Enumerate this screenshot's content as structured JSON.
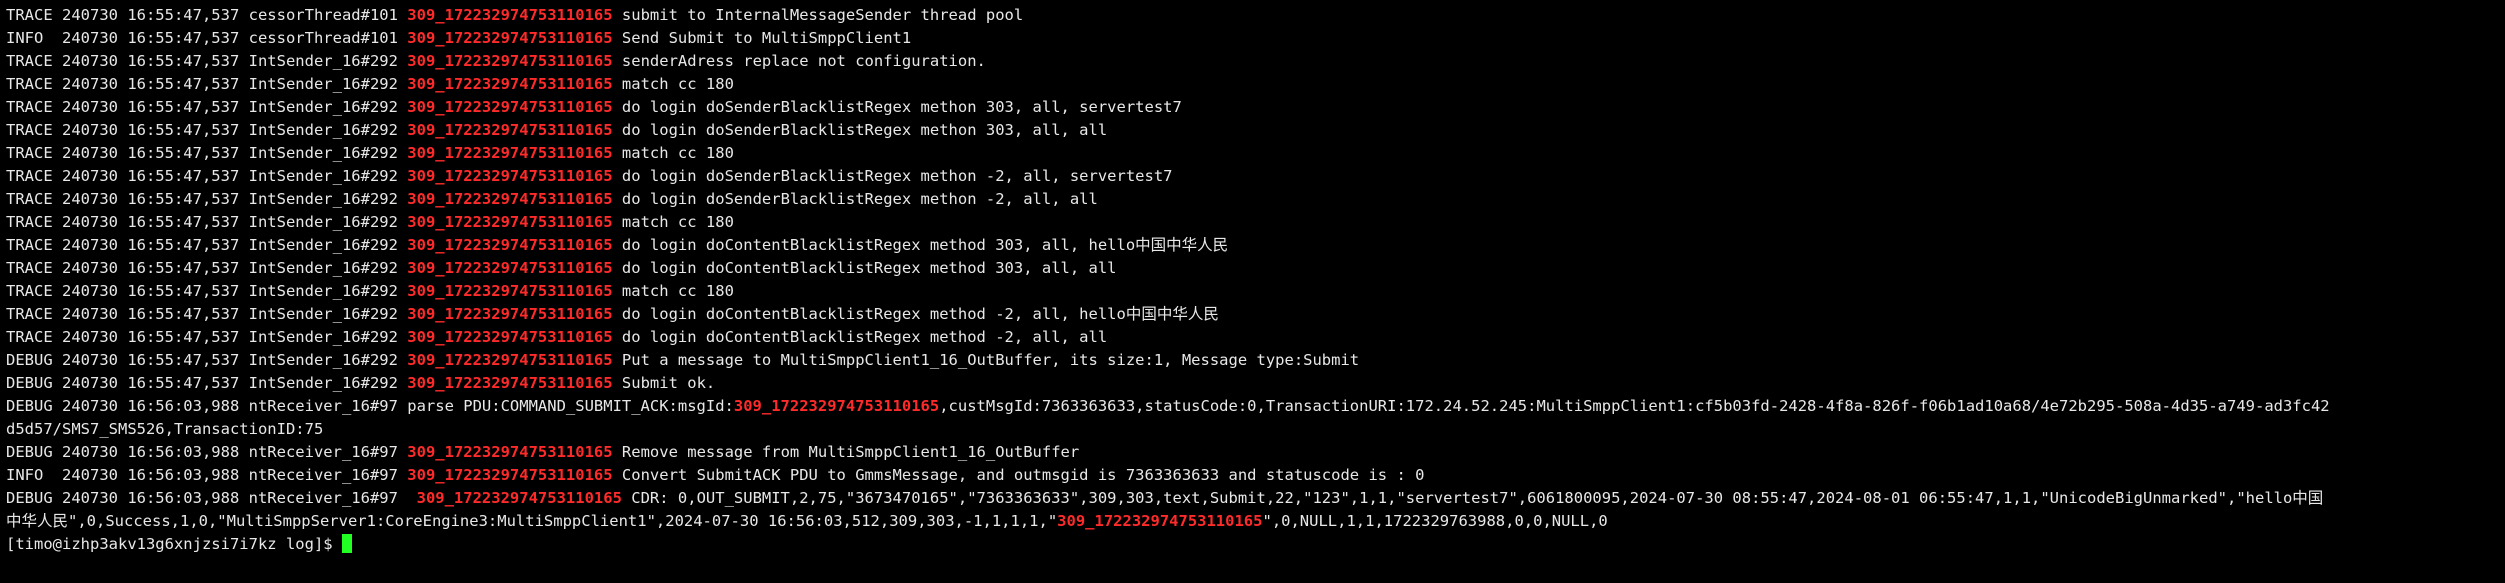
{
  "terminal": {
    "colors": {
      "background": "#000000",
      "foreground": "#e8e8e8",
      "highlight": "#ff2a2a",
      "cursor": "#22ff22"
    },
    "lines": [
      [
        {
          "t": "TRACE 240730 16:55:47,537 cessorThread#101 "
        },
        {
          "t": "309_172232974753110165",
          "red": true
        },
        {
          "t": " submit to InternalMessageSender thread pool"
        }
      ],
      [
        {
          "t": "INFO  240730 16:55:47,537 cessorThread#101 "
        },
        {
          "t": "309_172232974753110165",
          "red": true
        },
        {
          "t": " Send Submit to MultiSmppClient1"
        }
      ],
      [
        {
          "t": "TRACE 240730 16:55:47,537 IntSender_16#292 "
        },
        {
          "t": "309_172232974753110165",
          "red": true
        },
        {
          "t": " senderAdress replace not configuration."
        }
      ],
      [
        {
          "t": "TRACE 240730 16:55:47,537 IntSender_16#292 "
        },
        {
          "t": "309_172232974753110165",
          "red": true
        },
        {
          "t": " match cc 180"
        }
      ],
      [
        {
          "t": "TRACE 240730 16:55:47,537 IntSender_16#292 "
        },
        {
          "t": "309_172232974753110165",
          "red": true
        },
        {
          "t": " do login doSenderBlacklistRegex methon 303, all, servertest7"
        }
      ],
      [
        {
          "t": "TRACE 240730 16:55:47,537 IntSender_16#292 "
        },
        {
          "t": "309_172232974753110165",
          "red": true
        },
        {
          "t": " do login doSenderBlacklistRegex methon 303, all, all"
        }
      ],
      [
        {
          "t": "TRACE 240730 16:55:47,537 IntSender_16#292 "
        },
        {
          "t": "309_172232974753110165",
          "red": true
        },
        {
          "t": " match cc 180"
        }
      ],
      [
        {
          "t": "TRACE 240730 16:55:47,537 IntSender_16#292 "
        },
        {
          "t": "309_172232974753110165",
          "red": true
        },
        {
          "t": " do login doSenderBlacklistRegex methon -2, all, servertest7"
        }
      ],
      [
        {
          "t": "TRACE 240730 16:55:47,537 IntSender_16#292 "
        },
        {
          "t": "309_172232974753110165",
          "red": true
        },
        {
          "t": " do login doSenderBlacklistRegex methon -2, all, all"
        }
      ],
      [
        {
          "t": "TRACE 240730 16:55:47,537 IntSender_16#292 "
        },
        {
          "t": "309_172232974753110165",
          "red": true
        },
        {
          "t": " match cc 180"
        }
      ],
      [
        {
          "t": "TRACE 240730 16:55:47,537 IntSender_16#292 "
        },
        {
          "t": "309_172232974753110165",
          "red": true
        },
        {
          "t": " do login doContentBlacklistRegex method 303, all, hello中国中华人民"
        }
      ],
      [
        {
          "t": "TRACE 240730 16:55:47,537 IntSender_16#292 "
        },
        {
          "t": "309_172232974753110165",
          "red": true
        },
        {
          "t": " do login doContentBlacklistRegex method 303, all, all"
        }
      ],
      [
        {
          "t": "TRACE 240730 16:55:47,537 IntSender_16#292 "
        },
        {
          "t": "309_172232974753110165",
          "red": true
        },
        {
          "t": " match cc 180"
        }
      ],
      [
        {
          "t": "TRACE 240730 16:55:47,537 IntSender_16#292 "
        },
        {
          "t": "309_172232974753110165",
          "red": true
        },
        {
          "t": " do login doContentBlacklistRegex method -2, all, hello中国中华人民"
        }
      ],
      [
        {
          "t": "TRACE 240730 16:55:47,537 IntSender_16#292 "
        },
        {
          "t": "309_172232974753110165",
          "red": true
        },
        {
          "t": " do login doContentBlacklistRegex method -2, all, all"
        }
      ],
      [
        {
          "t": "DEBUG 240730 16:55:47,537 IntSender_16#292 "
        },
        {
          "t": "309_172232974753110165",
          "red": true
        },
        {
          "t": " Put a message to MultiSmppClient1_16_OutBuffer, its size:1, Message type:Submit"
        }
      ],
      [
        {
          "t": "DEBUG 240730 16:55:47,537 IntSender_16#292 "
        },
        {
          "t": "309_172232974753110165",
          "red": true
        },
        {
          "t": " Submit ok."
        }
      ],
      [
        {
          "t": "DEBUG 240730 16:56:03,988 ntReceiver_16#97 parse PDU:COMMAND_SUBMIT_ACK:msgId:"
        },
        {
          "t": "309_172232974753110165",
          "red": true
        },
        {
          "t": ",custMsgId:7363363633,statusCode:0,TransactionURI:172.24.52.245:MultiSmppClient1:cf5b03fd-2428-4f8a-826f-f06b1ad10a68/4e72b295-508a-4d35-a749-ad3fc42"
        }
      ],
      [
        {
          "t": "d5d57/SMS7_SMS526,TransactionID:75"
        }
      ],
      [
        {
          "t": "DEBUG 240730 16:56:03,988 ntReceiver_16#97 "
        },
        {
          "t": "309_172232974753110165",
          "red": true
        },
        {
          "t": " Remove message from MultiSmppClient1_16_OutBuffer"
        }
      ],
      [
        {
          "t": "INFO  240730 16:56:03,988 ntReceiver_16#97 "
        },
        {
          "t": "309_172232974753110165",
          "red": true
        },
        {
          "t": " Convert SubmitACK PDU to GmmsMessage, and outmsgid is 7363363633 and statuscode is : 0"
        }
      ],
      [
        {
          "t": "DEBUG 240730 16:56:03,988 ntReceiver_16#97  "
        },
        {
          "t": "309_172232974753110165",
          "red": true
        },
        {
          "t": " CDR: 0,OUT_SUBMIT,2,75,\"3673470165\",\"7363363633\",309,303,text,Submit,22,\"123\",1,1,\"servertest7\",6061800095,2024-07-30 08:55:47,2024-08-01 06:55:47,1,1,\"UnicodeBigUnmarked\",\"hello中国"
        }
      ],
      [
        {
          "t": "中华人民\",0,Success,1,0,\"MultiSmppServer1:CoreEngine3:MultiSmppClient1\",2024-07-30 16:56:03,512,309,303,-1,1,1,1,\""
        },
        {
          "t": "309_172232974753110165",
          "red": true
        },
        {
          "t": "\",0,NULL,1,1,1722329763988,0,0,NULL,0"
        }
      ]
    ],
    "prompt": "[timo@izhp3akv13g6xnjzsi7i7kz log]$ "
  }
}
